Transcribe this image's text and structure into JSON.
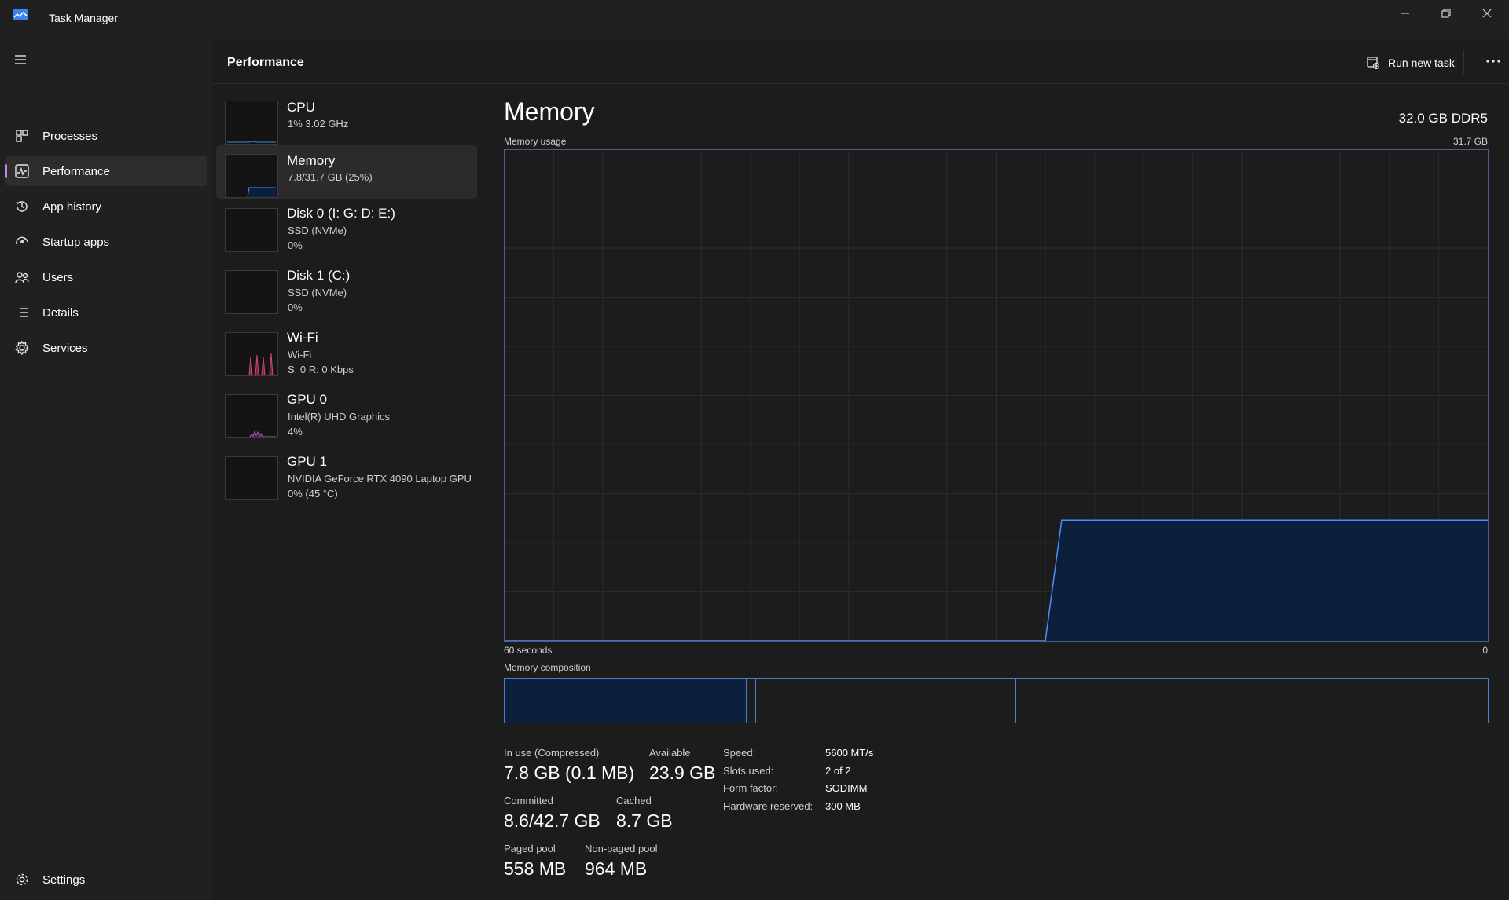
{
  "window": {
    "title": "Task Manager"
  },
  "sidebar": {
    "items": [
      {
        "label": "Processes",
        "icon": "processes-icon"
      },
      {
        "label": "Performance",
        "icon": "performance-icon",
        "active": true
      },
      {
        "label": "App history",
        "icon": "history-icon"
      },
      {
        "label": "Startup apps",
        "icon": "startup-icon"
      },
      {
        "label": "Users",
        "icon": "users-icon"
      },
      {
        "label": "Details",
        "icon": "details-icon"
      },
      {
        "label": "Services",
        "icon": "services-icon"
      }
    ],
    "settings_label": "Settings"
  },
  "header": {
    "title": "Performance",
    "run_task_label": "Run new task"
  },
  "devices": [
    {
      "name": "CPU",
      "line1": "1%  3.02 GHz",
      "line2": ""
    },
    {
      "name": "Memory",
      "line1": "7.8/31.7 GB (25%)",
      "line2": "",
      "active": true
    },
    {
      "name": "Disk 0 (I: G: D: E:)",
      "line1": "SSD (NVMe)",
      "line2": "0%"
    },
    {
      "name": "Disk 1 (C:)",
      "line1": "SSD (NVMe)",
      "line2": "0%"
    },
    {
      "name": "Wi-Fi",
      "line1": "Wi-Fi",
      "line2": "S: 0  R: 0 Kbps"
    },
    {
      "name": "GPU 0",
      "line1": "Intel(R) UHD Graphics",
      "line2": "4%"
    },
    {
      "name": "GPU 1",
      "line1": "NVIDIA GeForce RTX 4090 Laptop GPU",
      "line2": "0%  (45 °C)"
    }
  ],
  "memory": {
    "title": "Memory",
    "spec": "32.0 GB DDR5",
    "usage_label": "Memory usage",
    "max_label": "31.7 GB",
    "time_left": "60 seconds",
    "time_right": "0",
    "composition_label": "Memory composition"
  },
  "chart_data": {
    "type": "area",
    "title": "Memory usage",
    "x_unit": "seconds ago",
    "x": [
      60,
      27,
      26,
      20,
      15,
      10,
      5,
      0
    ],
    "values": [
      0,
      0,
      7.8,
      7.8,
      7.8,
      7.8,
      7.8,
      7.8
    ],
    "ylim": [
      0,
      31.7
    ],
    "xlim": [
      60,
      0
    ],
    "grid": true,
    "color": "#4c8ef7"
  },
  "composition": {
    "in_use_gb": 7.8,
    "modified_gb": 0.3,
    "standby_gb": 8.4,
    "free_gb": 15.2,
    "total_gb": 31.7
  },
  "stats": {
    "in_use": {
      "label": "In use (Compressed)",
      "value": "7.8 GB (0.1 MB)"
    },
    "available": {
      "label": "Available",
      "value": "23.9 GB"
    },
    "committed": {
      "label": "Committed",
      "value": "8.6/42.7 GB"
    },
    "cached": {
      "label": "Cached",
      "value": "8.7 GB"
    },
    "paged": {
      "label": "Paged pool",
      "value": "558 MB"
    },
    "nonpaged": {
      "label": "Non-paged pool",
      "value": "964 MB"
    }
  },
  "specs": [
    {
      "label": "Speed:",
      "value": "5600 MT/s"
    },
    {
      "label": "Slots used:",
      "value": "2 of 2"
    },
    {
      "label": "Form factor:",
      "value": "SODIMM"
    },
    {
      "label": "Hardware reserved:",
      "value": "300 MB"
    }
  ],
  "colors": {
    "accent": "#c389e6",
    "memory_line": "#4c8ef7",
    "memory_fill": "#0c1f3d",
    "wifi": "#d0467a",
    "gpu": "#b04fc0"
  }
}
